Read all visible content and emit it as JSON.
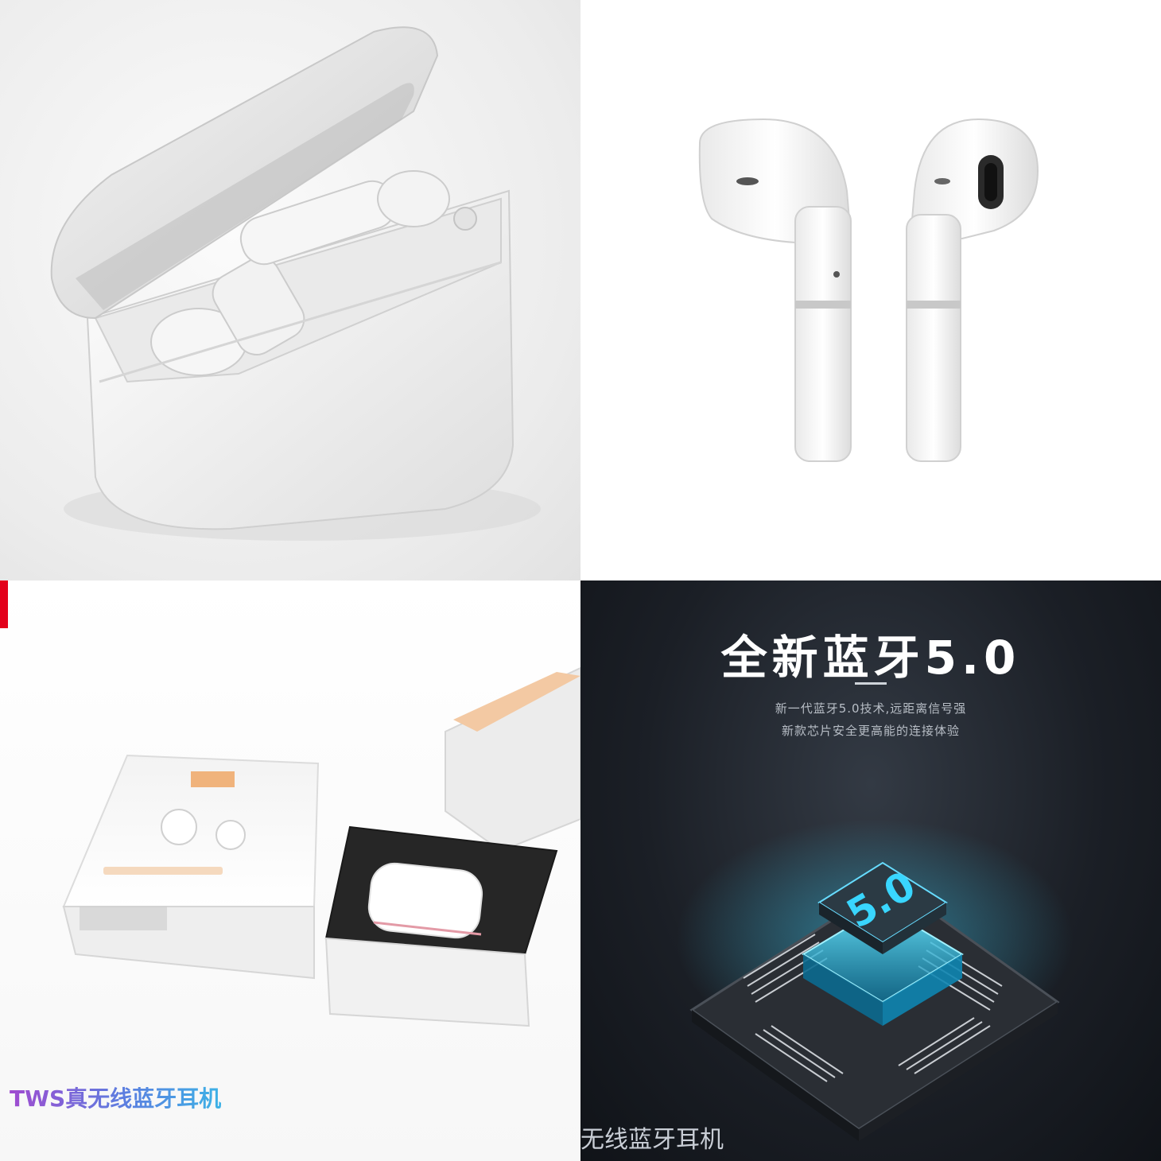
{
  "panels": {
    "case_photo": {},
    "earbuds_photo": {},
    "packaging_photo": {
      "caption": "TWS真无线蓝牙耳机"
    },
    "bluetooth_promo": {
      "title": "全新蓝牙5.0",
      "subtitle_line1": "新一代蓝牙5.0技术,远距离信号强",
      "subtitle_line2": "新款芯片安全更高能的连接体验",
      "chip_label": "5.0",
      "caption": "无线蓝牙耳机"
    }
  },
  "colors": {
    "accent_red": "#e3001b",
    "chip_glow": "#39d6ff",
    "dark_bg": "#1b1f26"
  }
}
